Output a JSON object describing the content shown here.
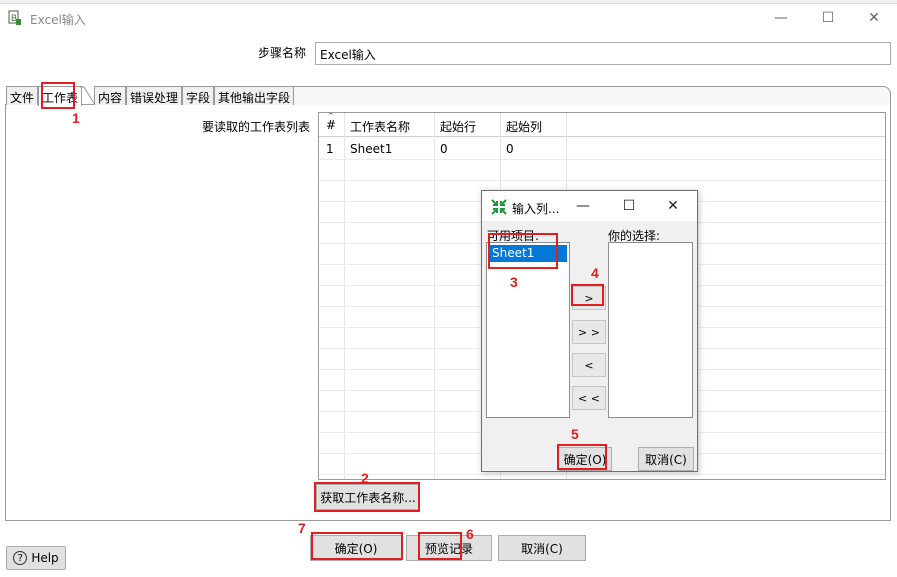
{
  "window": {
    "title": "Excel输入",
    "minimize_glyph": "—",
    "maximize_glyph": "☐",
    "close_glyph": "✕"
  },
  "step": {
    "label": "步骤名称",
    "value": "Excel输入"
  },
  "tabs": [
    {
      "label": "文件"
    },
    {
      "label": "工作表"
    },
    {
      "label": "内容"
    },
    {
      "label": "错误处理"
    },
    {
      "label": "字段"
    },
    {
      "label": "其他输出字段"
    }
  ],
  "sheets": {
    "label": "要读取的工作表列表",
    "columns": [
      "#",
      "工作表名称",
      "起始行",
      "起始列"
    ],
    "rows": [
      {
        "num": "1",
        "name": "Sheet1",
        "start_row": "0",
        "start_col": "0"
      }
    ]
  },
  "buttons": {
    "get_sheets": "获取工作表名称...",
    "ok": "确定(O)",
    "preview": "预览记录",
    "cancel": "取消(C)",
    "help": "Help"
  },
  "dialog": {
    "title": "输入列...",
    "available_label": "可用项目:",
    "selected_label": "你的选择:",
    "available_items": [
      "Sheet1"
    ],
    "move_one": ">",
    "move_all": "> >",
    "remove_one": "<",
    "remove_all": "< <",
    "ok": "确定(O)",
    "cancel": "取消(C)"
  },
  "annotations": [
    "1",
    "2",
    "3",
    "4",
    "5",
    "6",
    "7"
  ],
  "colors": {
    "annotation": "#e02020",
    "selection": "#0078d7",
    "dialog_icon": "#1a9a3a"
  }
}
